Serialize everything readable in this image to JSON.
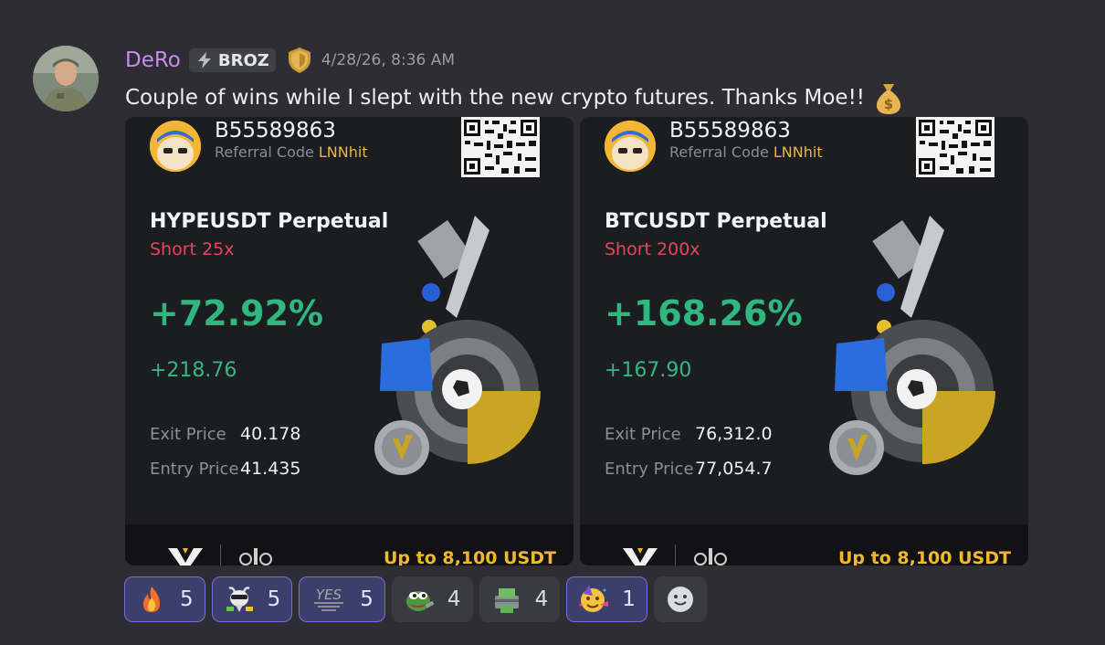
{
  "message": {
    "author": "DeRo",
    "tag": "BROZ",
    "timestamp": "4/28/26, 8:36 AM",
    "text": "Couple of wins while I slept with the new crypto futures. Thanks Moe!!",
    "text_emoji": "money-bag"
  },
  "cards": [
    {
      "uid": "B55589863",
      "referral_label": "Referral Code",
      "referral_code": "LNNhit",
      "pair": "HYPEUSDT Perpetual",
      "side": "Short 25x",
      "pct": "+72.92%",
      "pnl": "+218.76",
      "exit_label": "Exit Price",
      "exit_value": "40.178",
      "entry_label": "Entry Price",
      "entry_value": "41.435",
      "promo": "Up to 8,100 USDT"
    },
    {
      "uid": "B55589863",
      "referral_label": "Referral Code",
      "referral_code": "LNNhit",
      "pair": "BTCUSDT Perpetual",
      "side": "Short 200x",
      "pct": "+168.26%",
      "pnl": "+167.90",
      "exit_label": "Exit Price",
      "exit_value": "76,312.0",
      "entry_label": "Entry Price",
      "entry_value": "77,054.7",
      "promo": "Up to 8,100 USDT"
    }
  ],
  "reactions": [
    {
      "emoji": "fire",
      "count": "5",
      "active": true
    },
    {
      "emoji": "goat",
      "count": "5",
      "active": true
    },
    {
      "emoji": "yes-text",
      "count": "5",
      "active": true
    },
    {
      "emoji": "pepe",
      "count": "4",
      "active": false
    },
    {
      "emoji": "money-printer",
      "count": "4",
      "active": false
    },
    {
      "emoji": "party-face",
      "count": "1",
      "active": true
    }
  ],
  "reaction_yes_text": "YES",
  "colors": {
    "username": "#c88bf0",
    "profit": "#30b77f",
    "short": "#e5455e",
    "referral": "#e8b93a",
    "promo": "#f0b92c"
  }
}
